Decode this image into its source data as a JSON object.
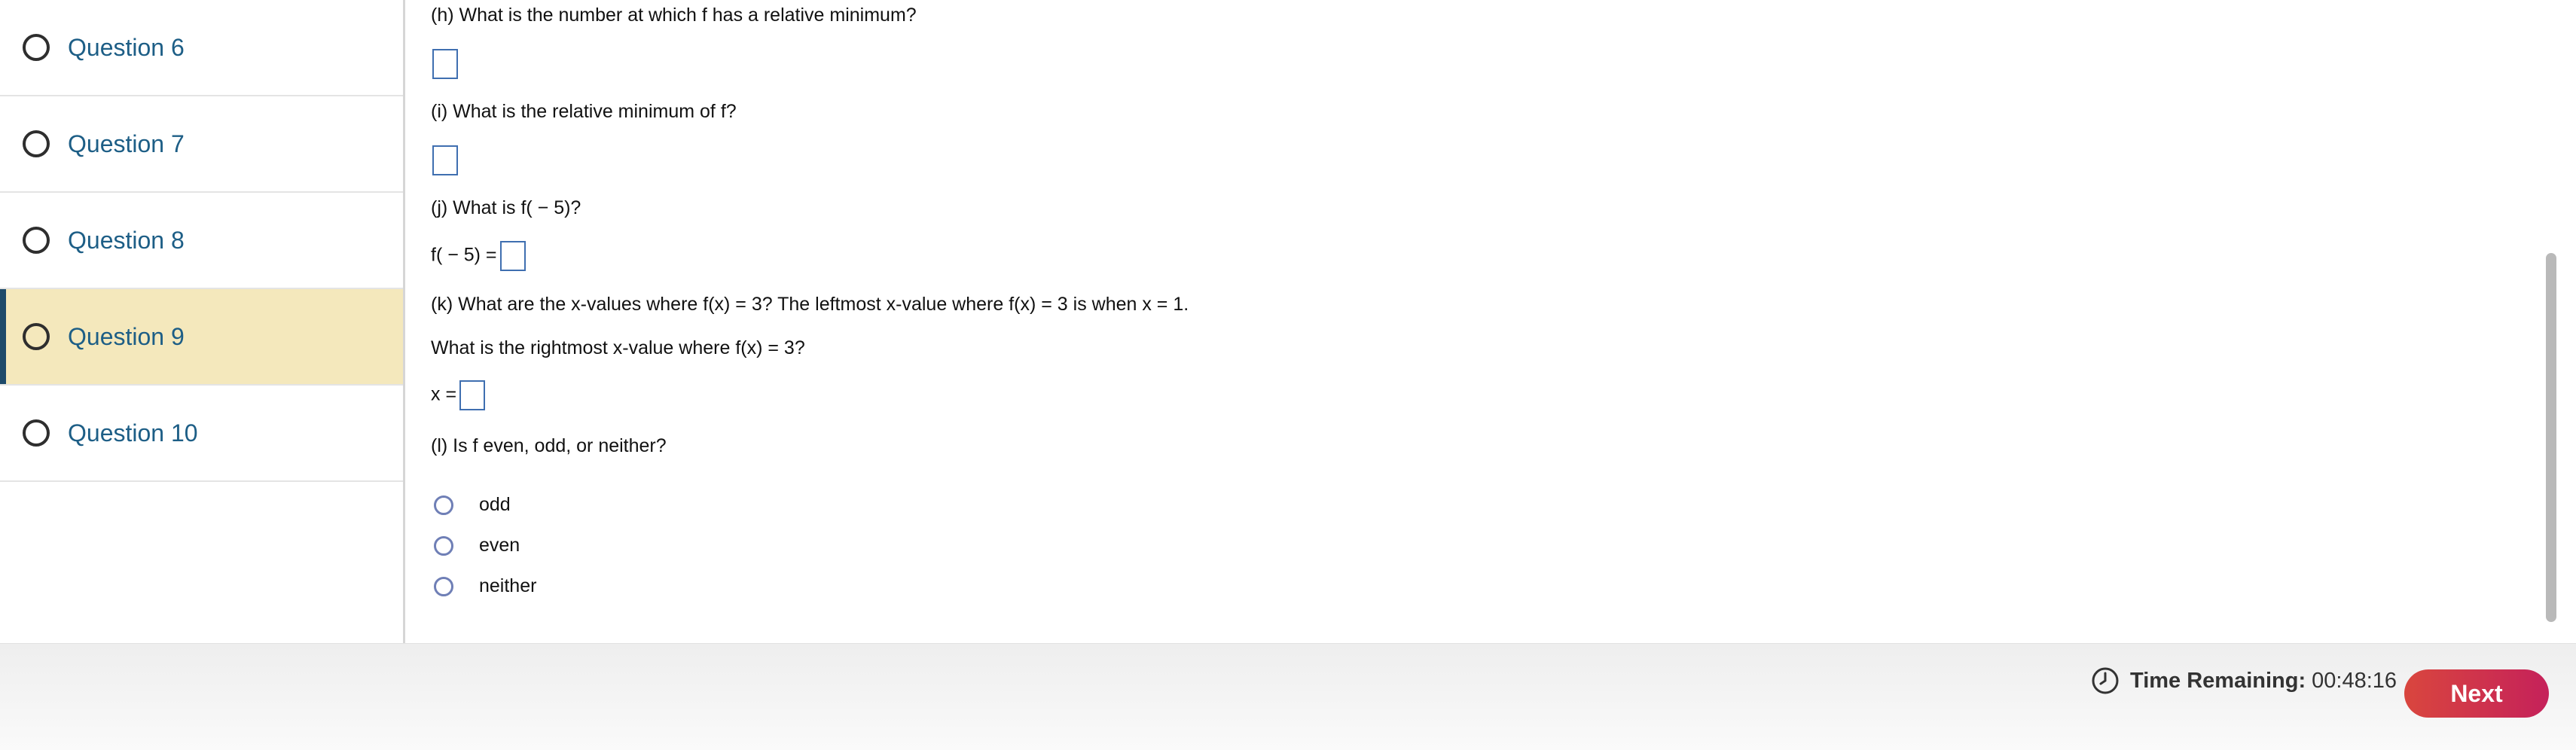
{
  "sidebar": {
    "items": [
      {
        "label": "Question 6"
      },
      {
        "label": "Question 7"
      },
      {
        "label": "Question 8"
      },
      {
        "label": "Question 9"
      },
      {
        "label": "Question 10"
      }
    ],
    "active_index": 3
  },
  "questions": {
    "h_text": "(h) What is the number at which f has a relative minimum?",
    "i_text": "(i) What is the relative minimum of f?",
    "j_text": "(j)  What is f( − 5)?",
    "j_prefix": "f( − 5) =",
    "k_text": "(k) What are the x-values where f(x) = 3?  The leftmost x-value where f(x) = 3 is when x = 1.",
    "k_sub": "What is the rightmost x-value where f(x) = 3?",
    "k_prefix": "x =",
    "l_text": "(l) Is f even, odd, or neither?",
    "l_options": [
      "odd",
      "even",
      "neither"
    ]
  },
  "footer": {
    "time_label": "Time Remaining:",
    "time_value": "00:48:16",
    "next_label": "Next"
  },
  "colors": {
    "accent_link": "#1d5e86",
    "active_bg": "#f4e8bc",
    "next_button": "#d2334a"
  },
  "icons": {
    "timer": "clock-icon",
    "question_status": "radio-circle-icon"
  }
}
